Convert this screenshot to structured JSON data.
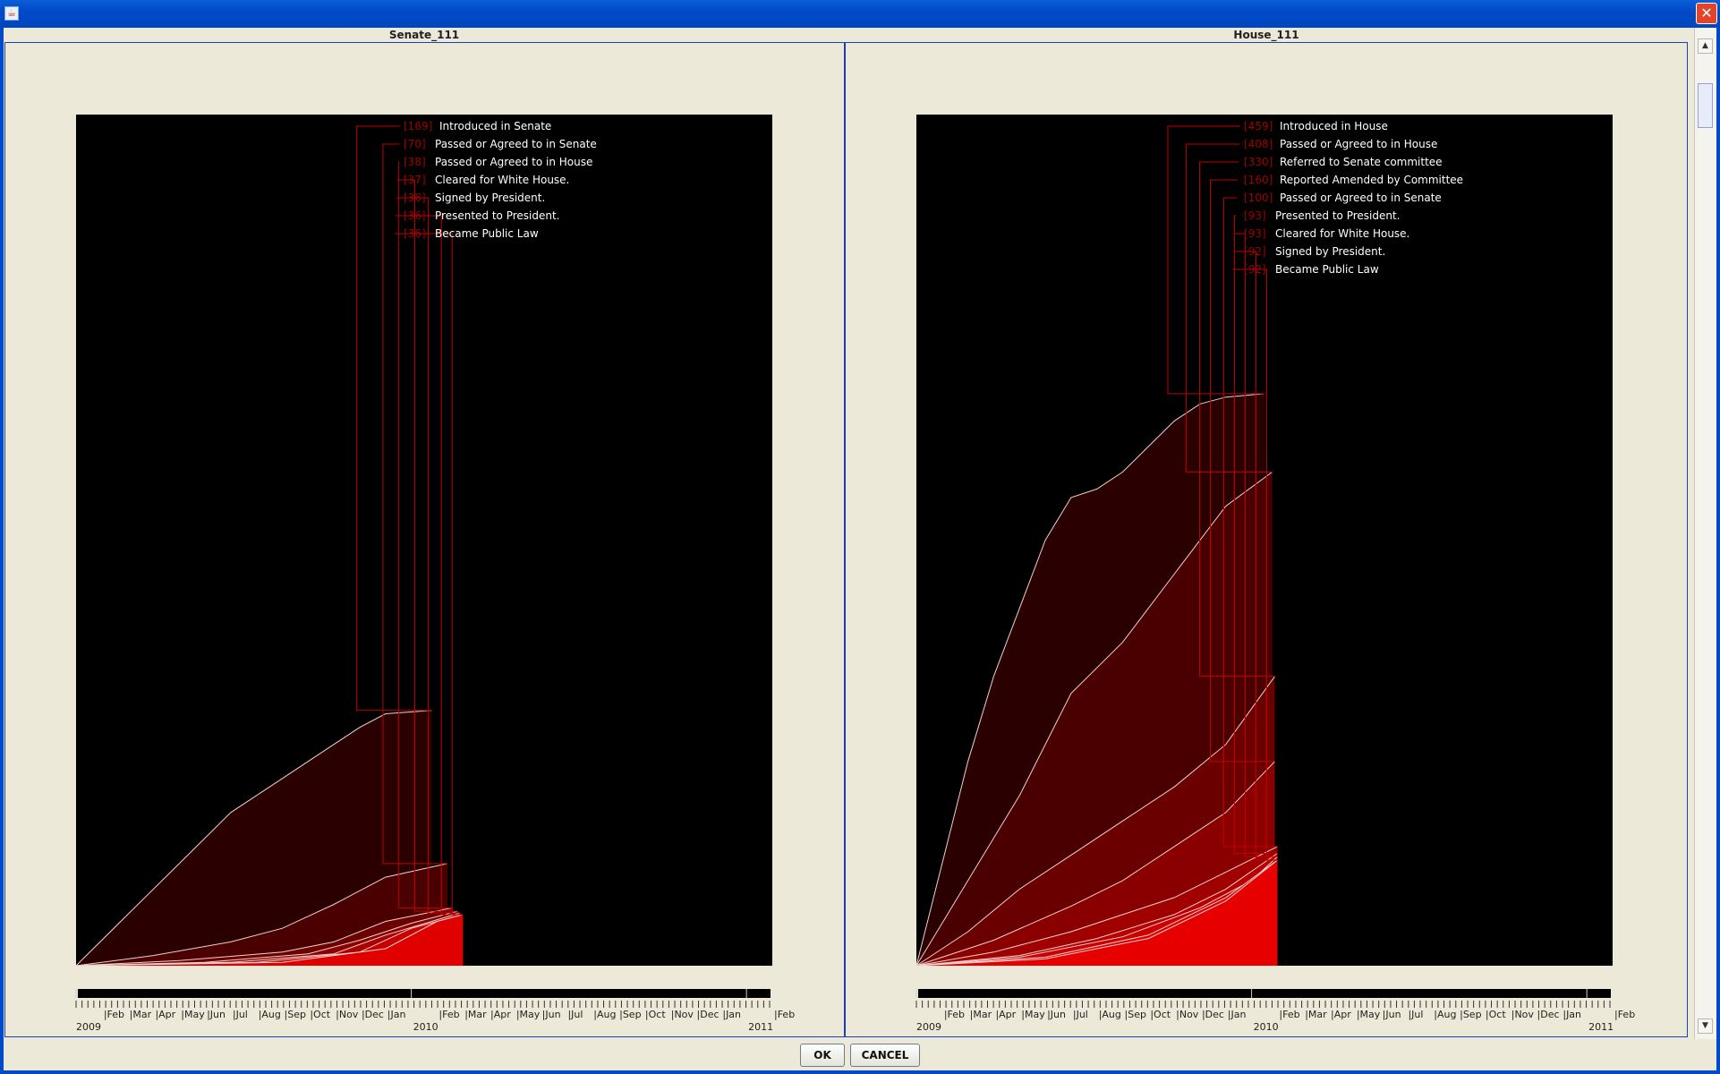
{
  "window": {
    "icon": "java-app-icon",
    "close_label": "✕"
  },
  "buttons": {
    "ok": "OK",
    "cancel": "CANCEL"
  },
  "scrollbar": {
    "up": "▲",
    "down": "▼"
  },
  "chart_data": [
    {
      "type": "area",
      "title": "Senate_111",
      "x_axis": {
        "start": "2009-01",
        "end": "2011-02",
        "month_labels": [
          "2009",
          "Feb",
          "Mar",
          "Apr",
          "May",
          "Jun",
          "Jul",
          "Aug",
          "Sep",
          "Oct",
          "Nov",
          "Dec",
          "Jan",
          "2010",
          "Feb",
          "Mar",
          "Apr",
          "May",
          "Jun",
          "Jul",
          "Aug",
          "Sep",
          "Oct",
          "Nov",
          "Dec",
          "Jan",
          "2011",
          "Feb"
        ]
      },
      "y_max": 500,
      "data_end_month": 14.0,
      "series": [
        {
          "name": "Introduced in Senate",
          "count": "169",
          "values": [
            [
              0,
              0
            ],
            [
              2,
              30
            ],
            [
              4,
              60
            ],
            [
              6,
              90
            ],
            [
              8,
              110
            ],
            [
              10,
              130
            ],
            [
              11,
              140
            ],
            [
              12,
              148
            ],
            [
              13.8,
              150
            ]
          ],
          "color": "#2a0000"
        },
        {
          "name": "Passed or Agreed to in Senate",
          "count": "70",
          "values": [
            [
              0,
              0
            ],
            [
              3,
              6
            ],
            [
              6,
              14
            ],
            [
              8,
              22
            ],
            [
              10,
              36
            ],
            [
              12,
              52
            ],
            [
              14.4,
              60
            ]
          ],
          "color": "#4a0000"
        },
        {
          "name": "Passed or Agreed to in House",
          "count": "38",
          "values": [
            [
              0,
              0
            ],
            [
              4,
              3
            ],
            [
              8,
              8
            ],
            [
              10,
              14
            ],
            [
              12,
              26
            ],
            [
              14.6,
              34
            ]
          ],
          "color": "#6a0000"
        },
        {
          "name": "Cleared for White House.",
          "count": "37",
          "values": [
            [
              0,
              0
            ],
            [
              5,
              2
            ],
            [
              9,
              7
            ],
            [
              11,
              15
            ],
            [
              13,
              25
            ],
            [
              14.8,
              32
            ]
          ],
          "color": "#8a0000"
        },
        {
          "name": "Signed by President.",
          "count": "36",
          "values": [
            [
              0,
              0
            ],
            [
              6,
              2
            ],
            [
              10,
              7
            ],
            [
              12,
              18
            ],
            [
              14.9,
              31
            ]
          ],
          "color": "#aa0000"
        },
        {
          "name": "Presented to President.",
          "count": "36",
          "values": [
            [
              0,
              0
            ],
            [
              7,
              2
            ],
            [
              11,
              8
            ],
            [
              13,
              22
            ],
            [
              15,
              30
            ]
          ],
          "color": "#c80000"
        },
        {
          "name": "Became Public Law",
          "count": "36",
          "values": [
            [
              0,
              0
            ],
            [
              8,
              2
            ],
            [
              12,
              10
            ],
            [
              14,
              26
            ],
            [
              15,
              30
            ]
          ],
          "color": "#e00000"
        }
      ]
    },
    {
      "type": "area",
      "title": "House_111",
      "x_axis": {
        "start": "2009-01",
        "end": "2011-02",
        "month_labels": [
          "2009",
          "Feb",
          "Mar",
          "Apr",
          "May",
          "Jun",
          "Jul",
          "Aug",
          "Sep",
          "Oct",
          "Nov",
          "Dec",
          "Jan",
          "2010",
          "Feb",
          "Mar",
          "Apr",
          "May",
          "Jun",
          "Jul",
          "Aug",
          "Sep",
          "Oct",
          "Nov",
          "Dec",
          "Jan",
          "2011",
          "Feb"
        ]
      },
      "y_max": 500,
      "data_end_month": 14.0,
      "series": [
        {
          "name": "Introduced in House",
          "count": "459",
          "values": [
            [
              0,
              0
            ],
            [
              1,
              60
            ],
            [
              2,
              120
            ],
            [
              3,
              170
            ],
            [
              4,
              210
            ],
            [
              5,
              250
            ],
            [
              6,
              275
            ],
            [
              7,
              280
            ],
            [
              8,
              290
            ],
            [
              9,
              305
            ],
            [
              10,
              320
            ],
            [
              11,
              330
            ],
            [
              12,
              334
            ],
            [
              13.5,
              336
            ]
          ],
          "color": "#2a0000"
        },
        {
          "name": "Passed or Agreed to in House",
          "count": "408",
          "values": [
            [
              0,
              0
            ],
            [
              2,
              50
            ],
            [
              4,
              100
            ],
            [
              6,
              160
            ],
            [
              8,
              190
            ],
            [
              10,
              230
            ],
            [
              12,
              270
            ],
            [
              13.8,
              290
            ]
          ],
          "color": "#4a0000"
        },
        {
          "name": "Referred to Senate committee",
          "count": "330",
          "values": [
            [
              0,
              0
            ],
            [
              2,
              20
            ],
            [
              4,
              45
            ],
            [
              6,
              65
            ],
            [
              8,
              85
            ],
            [
              10,
              105
            ],
            [
              12,
              130
            ],
            [
              13.9,
              170
            ]
          ],
          "color": "#6a0000"
        },
        {
          "name": "Reported Amended by Committee",
          "count": "160",
          "values": [
            [
              0,
              0
            ],
            [
              3,
              15
            ],
            [
              6,
              35
            ],
            [
              8,
              50
            ],
            [
              10,
              70
            ],
            [
              12,
              90
            ],
            [
              13.9,
              120
            ]
          ],
          "color": "#8a0000"
        },
        {
          "name": "Passed or Agreed to in Senate",
          "count": "100",
          "values": [
            [
              0,
              0
            ],
            [
              3,
              8
            ],
            [
              6,
              20
            ],
            [
              8,
              30
            ],
            [
              10,
              40
            ],
            [
              12,
              55
            ],
            [
              14,
              70
            ]
          ],
          "color": "#a00000"
        },
        {
          "name": "Presented to President.",
          "count": "93",
          "values": [
            [
              0,
              0
            ],
            [
              4,
              6
            ],
            [
              7,
              16
            ],
            [
              10,
              30
            ],
            [
              12,
              45
            ],
            [
              14,
              66
            ]
          ],
          "color": "#b80000"
        },
        {
          "name": "Cleared for White House.",
          "count": "93",
          "values": [
            [
              0,
              0
            ],
            [
              4,
              5
            ],
            [
              8,
              17
            ],
            [
              11,
              34
            ],
            [
              13,
              50
            ],
            [
              14,
              64
            ]
          ],
          "color": "#cc0000"
        },
        {
          "name": "Signed by President.",
          "count": "92",
          "values": [
            [
              0,
              0
            ],
            [
              5,
              5
            ],
            [
              9,
              18
            ],
            [
              12,
              40
            ],
            [
              14,
              62
            ]
          ],
          "color": "#dd0000"
        },
        {
          "name": "Became Public Law",
          "count": "92",
          "values": [
            [
              0,
              0
            ],
            [
              5,
              4
            ],
            [
              9,
              16
            ],
            [
              12,
              38
            ],
            [
              14,
              62
            ]
          ],
          "color": "#e60000"
        }
      ]
    }
  ]
}
